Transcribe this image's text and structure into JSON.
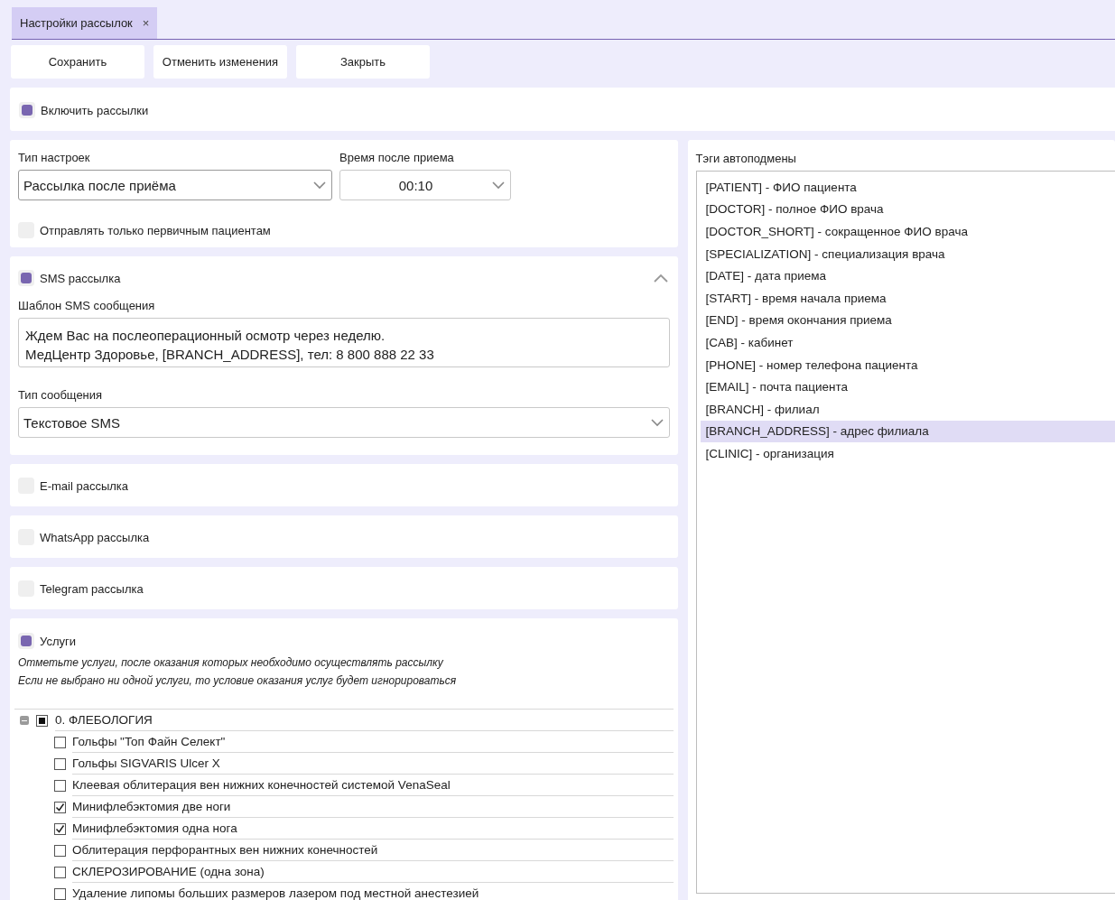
{
  "tab": {
    "label": "Настройки рассылок",
    "close": "×",
    "selected": true
  },
  "toolbar": {
    "buttons": [
      "Сохранить",
      "Отменить изменения",
      "Закрыть"
    ]
  },
  "enable_mailing": {
    "label": "Включить рассылки",
    "checked": true
  },
  "settings": {
    "settings_type": {
      "label": "Тип настроек",
      "value": "Рассылка после приёма"
    },
    "time_after": {
      "label": "Время после приема",
      "value": "00:10"
    },
    "primary_only": {
      "label": "Отправлять только первичным пациентам",
      "checked": false
    }
  },
  "sms_channel": {
    "label": "SMS рассылка",
    "checked": true,
    "expanded": true,
    "template": {
      "label": "Шаблон SMS сообщения",
      "value": "Ждем Вас на послеоперационный осмотр через неделю.\nМедЦентр Здоровье, [BRANCH_ADDRESS], тел: 8 800 888 22 33"
    },
    "message_type": {
      "label": "Тип сообщения",
      "value": "Текстовое SMS"
    }
  },
  "channels": [
    {
      "label": "E-mail рассылка",
      "checked": false
    },
    {
      "label": "WhatsApp рассылка",
      "checked": false
    },
    {
      "label": "Telegram рассылка",
      "checked": false
    }
  ],
  "services": {
    "label": "Услуги",
    "checked": true,
    "hints": [
      "Отметьте услуги, после оказания которых необходимо осуществлять рассылку",
      "Если не выбрано ни одной услуги, то условие оказания услуг будет игнорироваться"
    ],
    "tree": [
      {
        "label": "0. ФЛЕБОЛОГИЯ",
        "expanded": true,
        "checked": false,
        "indeterminate": true,
        "children": [
          {
            "label": "Гольфы \"Топ Файн Селект\"",
            "checked": false
          },
          {
            "label": "Гольфы SIGVARIS Ulcer X",
            "checked": false
          },
          {
            "label": "Клеевая облитерация вен нижних конечностей системой VenaSeal",
            "checked": false
          },
          {
            "label": "Минифлебэктомия две ноги",
            "checked": true
          },
          {
            "label": "Минифлебэктомия одна нога",
            "checked": true
          },
          {
            "label": "Облитерация перфорантных вен нижних конечностей",
            "checked": false
          },
          {
            "label": "СКЛЕРОЗИРОВАНИЕ (одна зона)",
            "checked": false
          },
          {
            "label": "Удаление липомы больших размеров лазером под местной анестезией",
            "checked": false
          }
        ]
      }
    ]
  },
  "tags": {
    "label": "Тэги автоподмены",
    "items": [
      {
        "label": "[PATIENT] - ФИО пациента",
        "selected": false
      },
      {
        "label": "[DOCTOR] - полное ФИО врача",
        "selected": false
      },
      {
        "label": "[DOCTOR_SHORT] - сокращенное ФИО врача",
        "selected": false
      },
      {
        "label": "[SPECIALIZATION] - специализация врача",
        "selected": false
      },
      {
        "label": "[DATE] - дата приема",
        "selected": false
      },
      {
        "label": "[START] - время начала приема",
        "selected": false
      },
      {
        "label": "[END] - время окончания приема",
        "selected": false
      },
      {
        "label": "[CAB] - кабинет",
        "selected": false
      },
      {
        "label": "[PHONE] - номер телефона пациента",
        "selected": false
      },
      {
        "label": "[EMAIL] - почта пациента",
        "selected": false
      },
      {
        "label": "[BRANCH] - филиал",
        "selected": false
      },
      {
        "label": "[BRANCH_ADDRESS] - адрес филиала",
        "selected": true
      },
      {
        "label": "[CLINIC] - организация",
        "selected": false
      }
    ]
  }
}
